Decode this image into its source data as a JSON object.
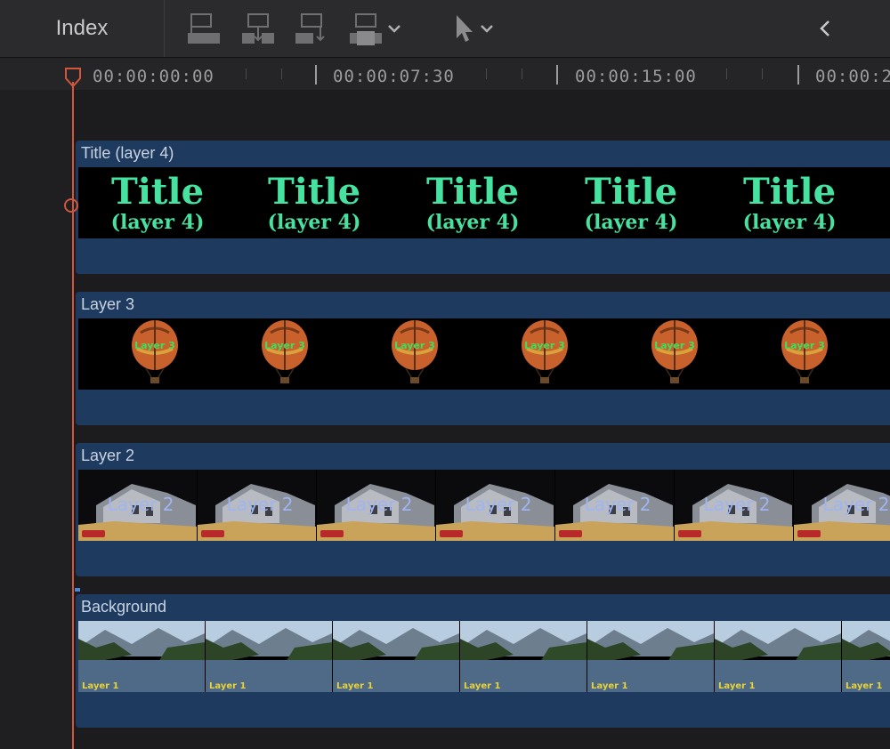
{
  "toolbar": {
    "index_label": "Index",
    "tools": [
      "connect-clip-icon",
      "insert-clip-icon",
      "append-clip-icon",
      "overwrite-clip-icon"
    ],
    "select_tool": "arrow-pointer-icon",
    "collapse_icon": "chevron-left-icon"
  },
  "ruler": {
    "timecodes": [
      "00:00:00:00",
      "00:00:07:30",
      "00:00:15:00",
      "00:00:2"
    ]
  },
  "tracks": [
    {
      "name": "Title (layer 4)",
      "title_text": "Title",
      "title_sub": "(layer 4)"
    },
    {
      "name": "Layer 3",
      "frame_label": "Layer 3"
    },
    {
      "name": "Layer 2",
      "frame_label": "Layer 2"
    },
    {
      "name": "Background",
      "frame_label": "Layer 1"
    }
  ],
  "colors": {
    "clip_bg": "#1f3a5f",
    "playhead": "#d2563b",
    "title_text": "#46e3a0"
  }
}
